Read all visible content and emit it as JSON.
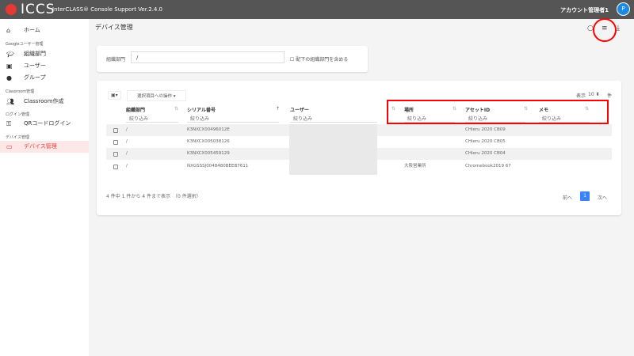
{
  "header": {
    "brand": "ICCS",
    "subtitle": "InterCLASS® Console Support  Ver.2.4.0",
    "account": "アカウント管理者1",
    "avatar": "P"
  },
  "sidebar": {
    "home": "ホーム",
    "sections": [
      "Googleユーザー管理",
      "Classroom管理",
      "ログイン管理",
      "デバイス管理"
    ],
    "items": [
      "組織部門",
      "ユーザー",
      "グループ",
      "Classroom作成",
      "QRコードログイン",
      "デバイス管理"
    ]
  },
  "page": {
    "title": "デバイス管理"
  },
  "filter": {
    "label": "組織部門",
    "value": "/",
    "include_sub": "配下の組織部門を含める"
  },
  "table": {
    "bulk_action": "選択項目への操作 ▾",
    "per_page_label": "表示",
    "per_page": "10",
    "per_page_unit": "件",
    "columns": [
      "組織部門",
      "シリアル番号",
      "ユーザー",
      "場所",
      "アセットID",
      "メモ"
    ],
    "filter_placeholder": "絞り込み",
    "rows": [
      {
        "org": "/",
        "serial": "K3NXCX00496012E",
        "location": "",
        "asset": "CHieru 2020 CB09"
      },
      {
        "org": "/",
        "serial": "K3NXCX005038126",
        "location": "",
        "asset": "CHieru 2020 CB05"
      },
      {
        "org": "/",
        "serial": "K3NXCX005459129",
        "location": "",
        "asset": "CHieru 2020 CB04"
      },
      {
        "org": "/",
        "serial": "NXGSSSJ0048480BEEB7611",
        "location": "大阪営業所",
        "asset": "Chromebook2019 67"
      }
    ],
    "summary": "4 件中 1 件から 4 件まで表示　（0 件選択）",
    "prev": "前へ",
    "page": "1",
    "next": "次へ"
  }
}
